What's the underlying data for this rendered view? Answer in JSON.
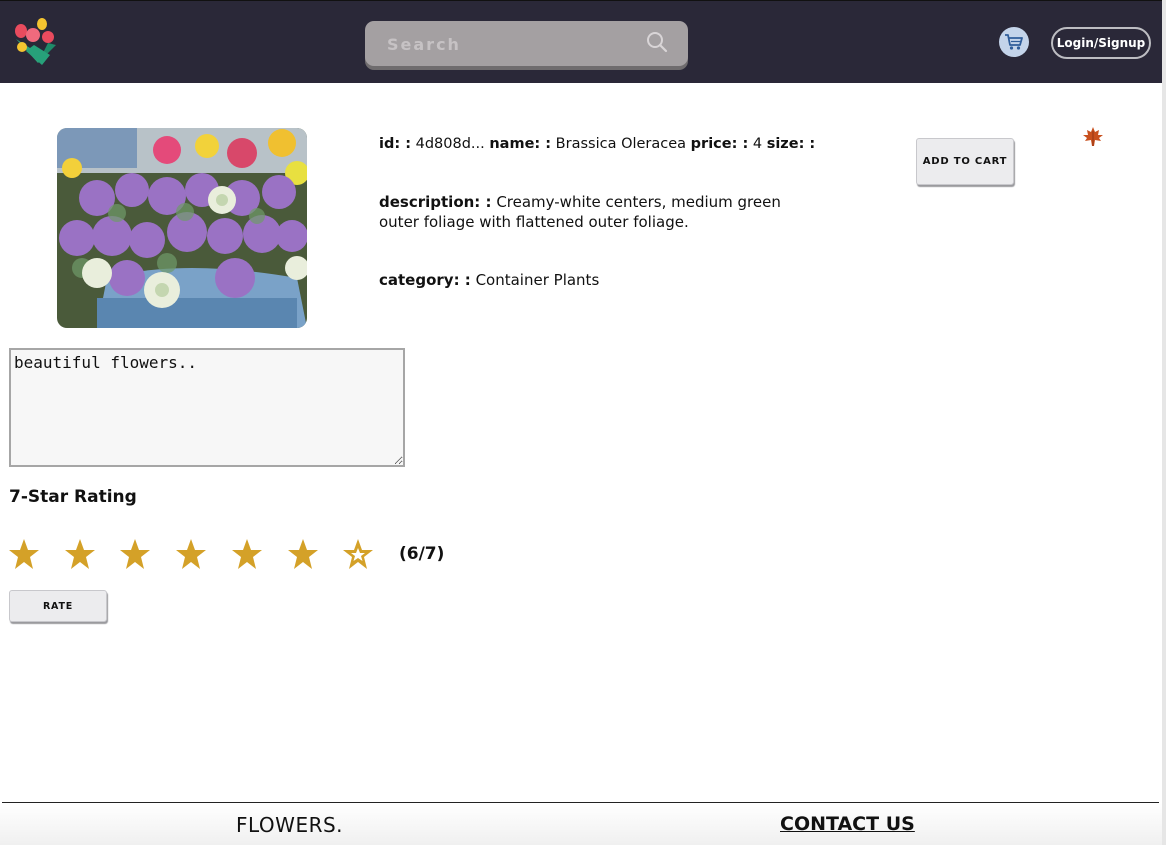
{
  "header": {
    "search": {
      "placeholder": "Search"
    },
    "login_label": "Login/Signup"
  },
  "product": {
    "id_label": "id: :",
    "id_value": "4d808d...",
    "name_label": "name: :",
    "name_value": "Brassica Oleracea",
    "price_label": "price: :",
    "price_value": "4",
    "size_label": "size: :",
    "size_value": "",
    "description_label": "description: :",
    "description_value": "Creamy-white centers, medium green outer foliage with flattened outer foliage.",
    "category_label": "category: :",
    "category_value": "Container Plants",
    "add_to_cart_label": "ADD TO CART"
  },
  "review": {
    "comment_value": "beautiful flowers..",
    "rating_title": "7-Star Rating",
    "rating": 6,
    "max_rating": 7,
    "rating_display": "(6/7)",
    "rate_label": "RATE"
  },
  "footer": {
    "brand": "FLOWERS.",
    "contact_label": "CONTACT US"
  },
  "colors": {
    "header_bg": "#2a2838",
    "star": "#d4a128",
    "search_bg": "#a4a0a2"
  },
  "icons": {
    "logo": "flower-bouquet-icon",
    "search": "search-icon",
    "cart": "cart-icon",
    "leaf": "maple-leaf-icon"
  }
}
